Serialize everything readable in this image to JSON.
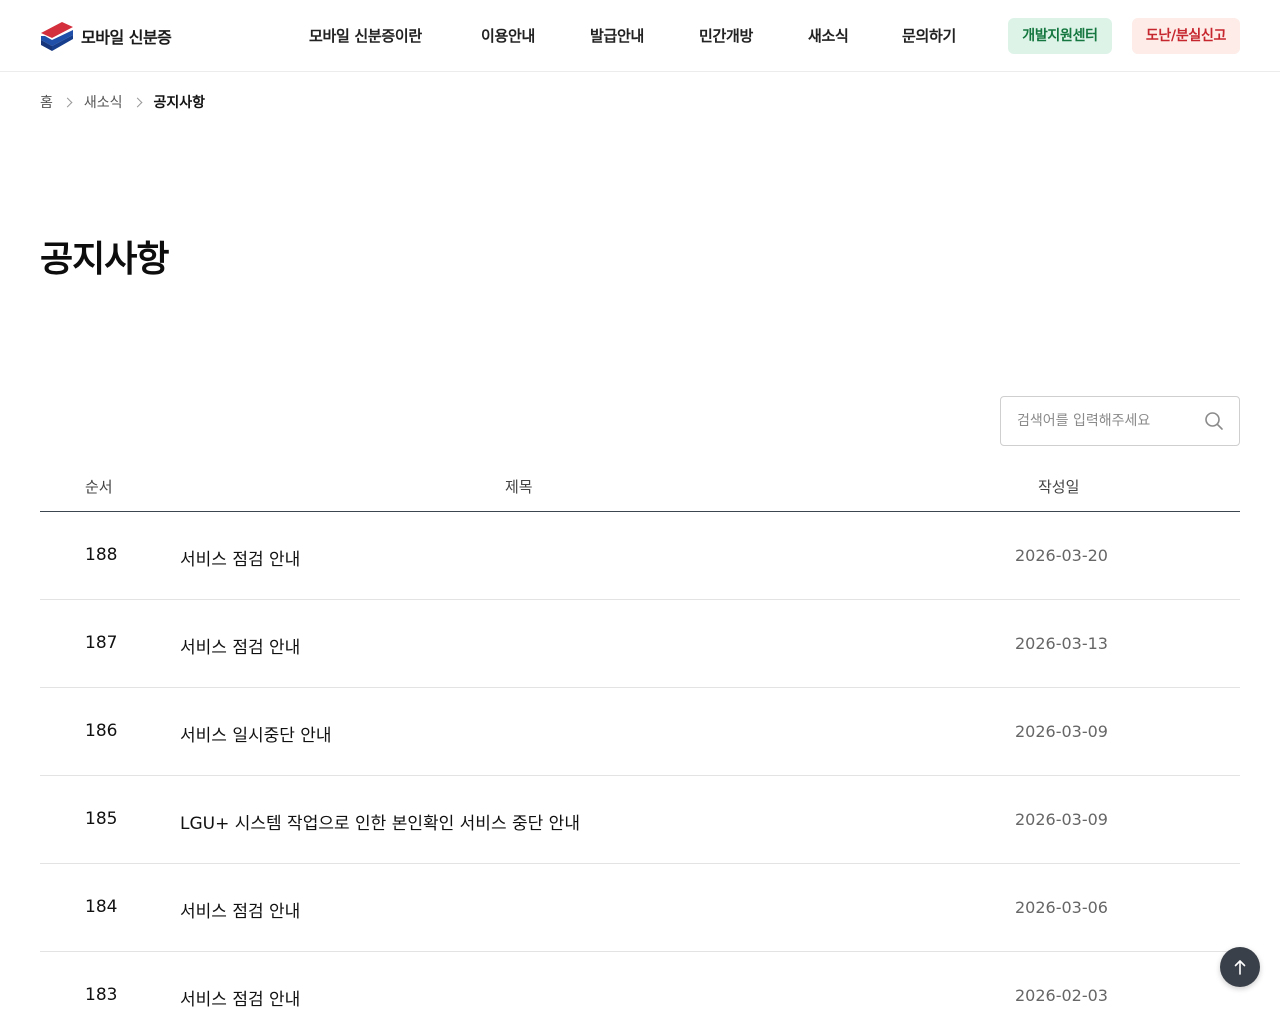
{
  "header": {
    "logo_text": "모바일 신분증",
    "nav": [
      {
        "label": "모바일 신분증이란"
      },
      {
        "label": "이용안내"
      },
      {
        "label": "발급안내"
      },
      {
        "label": "민간개방"
      },
      {
        "label": "새소식"
      },
      {
        "label": "문의하기"
      }
    ],
    "dev_center_label": "개발지원센터",
    "report_label": "도난/분실신고"
  },
  "breadcrumb": {
    "home": "홈",
    "section": "새소식",
    "current": "공지사항"
  },
  "page_title": "공지사항",
  "search": {
    "placeholder": "검색어를 입력해주세요",
    "value": ""
  },
  "table": {
    "headers": {
      "no": "순서",
      "title": "제목",
      "date": "작성일"
    },
    "rows": [
      {
        "no": "188",
        "title": "서비스 점검 안내",
        "date": "2026-03-20"
      },
      {
        "no": "187",
        "title": "서비스 점검 안내",
        "date": "2026-03-13"
      },
      {
        "no": "186",
        "title": "서비스 일시중단 안내",
        "date": "2026-03-09"
      },
      {
        "no": "185",
        "title": "LGU+ 시스템 작업으로 인한 본인확인 서비스 중단 안내",
        "date": "2026-03-09"
      },
      {
        "no": "184",
        "title": "서비스 점검 안내",
        "date": "2026-03-06"
      },
      {
        "no": "183",
        "title": "서비스 점검 안내",
        "date": "2026-02-03"
      }
    ]
  },
  "colors": {
    "dev_center_bg": "#ddf3e8",
    "dev_center_text": "#15773f",
    "report_bg": "#fdece8",
    "report_text": "#c6262e",
    "table_head_line": "#3c4650",
    "top_button": "#3a4049"
  },
  "icons": {
    "logo": "mobile-id-logo-icon",
    "search": "search-icon",
    "breadcrumb_separator": "chevron-right-icon",
    "scroll_top": "arrow-up-icon"
  }
}
